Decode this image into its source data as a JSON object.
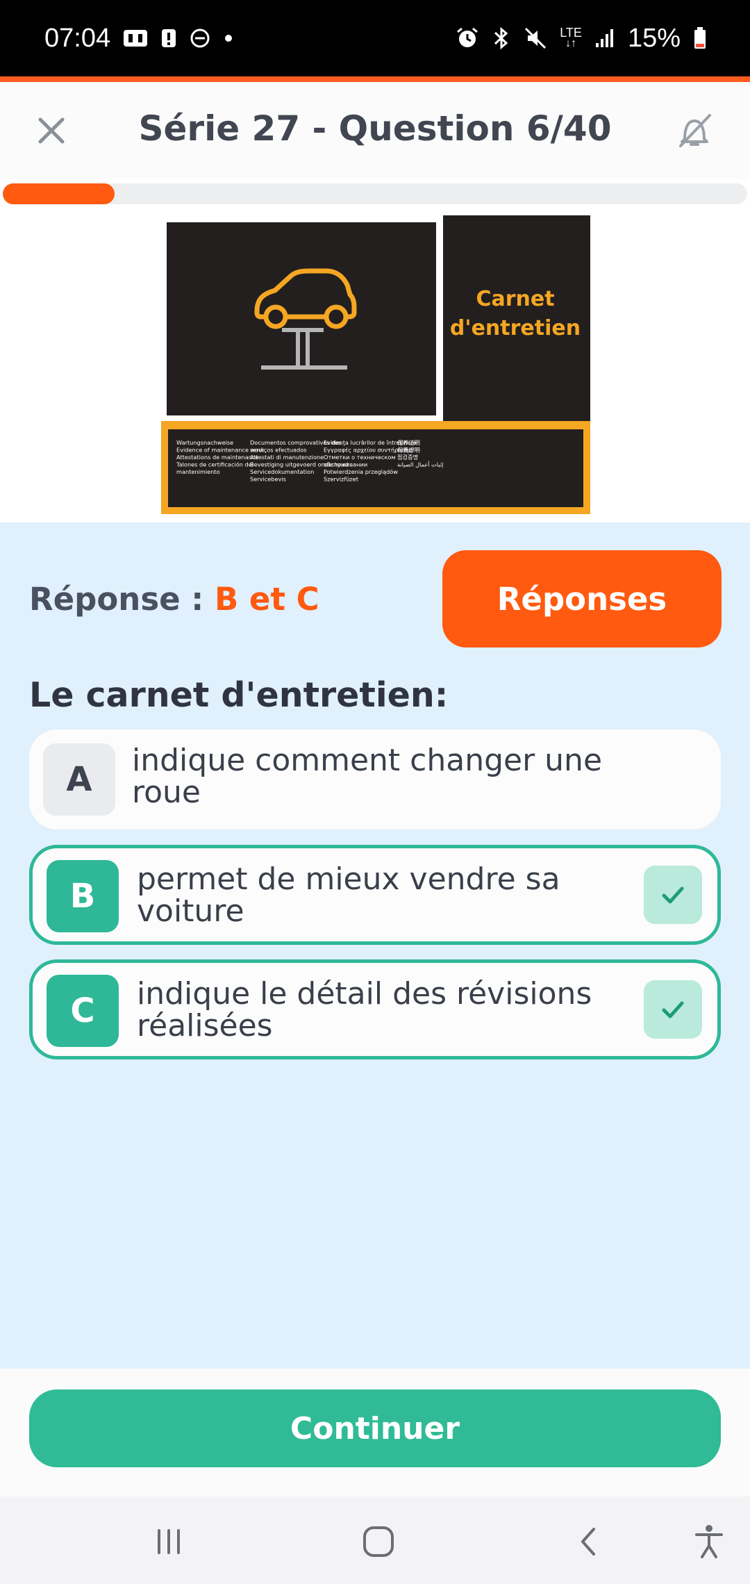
{
  "status_bar": {
    "time": "07:04",
    "network": "LTE",
    "battery": "15%",
    "icons": [
      "media-icon",
      "alert-icon",
      "dnd-icon",
      "dot-icon",
      "alarm-icon",
      "bluetooth-icon",
      "mute-icon",
      "lte-icon",
      "signal-icon",
      "battery-icon"
    ]
  },
  "header": {
    "title": "Série 27 - Question 6/40",
    "close_icon": "close-icon",
    "sound_icon": "sound-off-icon"
  },
  "progress": {
    "current": 6,
    "total": 40,
    "fraction": 0.15
  },
  "illustration": {
    "title_line1": "Carnet",
    "title_line2": "d'entretien",
    "footer_col1": [
      "Wartungsnachweise",
      "Evidence of maintenance work",
      "Attestations de maintenance",
      "Talones de certificación del",
      "mantenimiento"
    ],
    "footer_col2": [
      "Documentos comprovativos dos",
      "serviços efectuados",
      "Attestati di manutenzione",
      "Bevestiging uitgevoerd onderhoud",
      "Servicedokumentation",
      "Servicebevis"
    ],
    "footer_col3": [
      "Evidenţa lucrărilor de întreţinere",
      "Εγγραφές αρχείου συντήρησης",
      "Отметки о техническом",
      "обслуживании",
      "Potwierdzenia przeglądów",
      "Szervizfüzet"
    ],
    "footer_col4": [
      "保养证明",
      "保養證明",
      "점검증명",
      "إثبات أعمال الصيانة"
    ],
    "colors": {
      "dark": "#231f1e",
      "accent": "#f5a623"
    }
  },
  "answer": {
    "label": "Réponse : ",
    "value": "B et C",
    "reponses_button": "Réponses"
  },
  "question": "Le carnet d'entretien:",
  "options": [
    {
      "letter": "A",
      "text_line1": "indique comment changer une",
      "text_line2": "roue",
      "selected": false
    },
    {
      "letter": "B",
      "text_line1": "permet de mieux vendre sa",
      "text_line2": "voiture",
      "selected": true
    },
    {
      "letter": "C",
      "text_line1": "indique le détail des révisions",
      "text_line2": "réalisées",
      "selected": true
    }
  ],
  "continue_button": "Continuer",
  "nav": [
    "recents-icon",
    "home-icon",
    "back-icon",
    "accessibility-icon"
  ],
  "colors": {
    "orange": "#ff5a0f",
    "green": "#2eb897",
    "answer_bg": "#e0f0fd"
  }
}
